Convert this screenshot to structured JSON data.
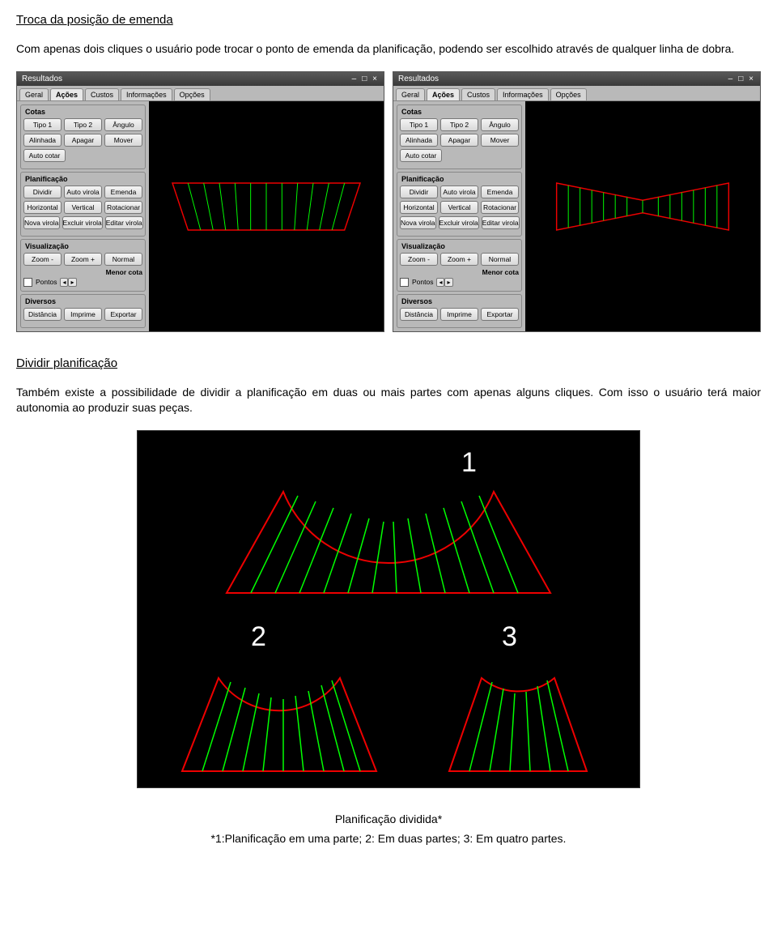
{
  "section1": {
    "title": "Troca da posição de emenda",
    "para": "Com apenas dois cliques o usuário pode trocar o ponto de emenda da planificação, podendo ser escolhido através de qualquer linha de dobra."
  },
  "window": {
    "title": "Resultados",
    "winicons": [
      "–",
      "□",
      "×"
    ],
    "tabs": [
      "Geral",
      "Ações",
      "Custos",
      "Informações",
      "Opções"
    ],
    "active_tab": "Ações",
    "groups": {
      "cotas": {
        "title": "Cotas",
        "row1": [
          "Tipo 1",
          "Tipo 2",
          "Ângulo"
        ],
        "row2": [
          "Alinhada",
          "Apagar",
          "Mover"
        ],
        "row3": [
          "Auto cotar"
        ]
      },
      "plan": {
        "title": "Planificação",
        "row1": [
          "Dividir",
          "Auto virola",
          "Emenda"
        ],
        "row2": [
          "Horizontal",
          "Vertical",
          "Rotacionar"
        ],
        "row3": [
          "Nova virola",
          "Excluir virola",
          "Editar virola"
        ]
      },
      "vis": {
        "title": "Visualização",
        "row1": [
          "Zoom -",
          "Zoom +",
          "Normal"
        ],
        "menor": "Menor cota",
        "pontos": "Pontos"
      },
      "div": {
        "title": "Diversos",
        "row1": [
          "Distância",
          "Imprime",
          "Exportar"
        ]
      }
    }
  },
  "section2": {
    "title": "Dividir planificação",
    "para": "Também existe a possibilidade de dividir a planificação em duas ou mais partes com apenas alguns cliques. Com isso o usuário terá maior autonomia ao produzir suas peças."
  },
  "fig_numbers": [
    "1",
    "2",
    "3"
  ],
  "caption": "Planificação dividida*",
  "footnote": "*1:Planificação em uma parte; 2: Em duas partes; 3: Em quatro partes."
}
